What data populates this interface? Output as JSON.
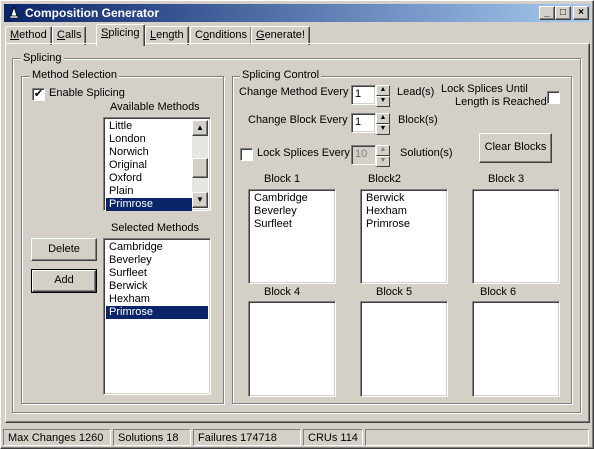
{
  "window": {
    "title": "Composition Generator",
    "minimize_glyph": "_",
    "maximize_glyph": "□",
    "close_glyph": "×"
  },
  "tabs": [
    {
      "pre": "",
      "accel": "M",
      "post": "ethod"
    },
    {
      "pre": "",
      "accel": "C",
      "post": "alls"
    },
    {
      "pre": "",
      "accel": "S",
      "post": "plicing"
    },
    {
      "pre": "",
      "accel": "L",
      "post": "ength"
    },
    {
      "pre": "C",
      "accel": "o",
      "post": "nditions"
    },
    {
      "pre": "",
      "accel": "G",
      "post": "enerate!"
    }
  ],
  "active_tab": "Splicing",
  "splicing": {
    "group_label": "Splicing",
    "method_selection": {
      "label": "Method Selection",
      "enable_label": "Enable Splicing",
      "enable_checked": true,
      "available_label": "Available Methods",
      "available_methods": [
        "Little",
        "London",
        "Norwich",
        "Original",
        "Oxford",
        "Plain",
        "Primrose"
      ],
      "available_selected": "Primrose",
      "selected_label": "Selected Methods",
      "selected_methods": [
        "Cambridge",
        "Beverley",
        "Surfleet",
        "Berwick",
        "Hexham",
        "Primrose"
      ],
      "selected_selected": "Primrose",
      "delete_button": "Delete",
      "add_button": "Add"
    },
    "control": {
      "label": "Splicing Control",
      "change_method_label": "Change Method Every",
      "change_method_value": "1",
      "change_method_unit": "Lead(s)",
      "lock_until_label_1": "Lock Splices Until",
      "lock_until_label_2": "Length is Reached",
      "lock_until_checked": false,
      "change_block_label": "Change Block Every",
      "change_block_value": "1",
      "change_block_unit": "Block(s)",
      "lock_every_label": "Lock Splices Every",
      "lock_every_checked": false,
      "lock_every_value": "10",
      "lock_every_unit": "Solution(s)",
      "clear_blocks_button": "Clear Blocks",
      "blocks": [
        {
          "title": "Block 1",
          "items": [
            "Cambridge",
            "Beverley",
            "Surfleet"
          ]
        },
        {
          "title": "Block2",
          "items": [
            "Berwick",
            "Hexham",
            "Primrose"
          ]
        },
        {
          "title": "Block 3",
          "items": []
        },
        {
          "title": "Block 4",
          "items": []
        },
        {
          "title": "Block 5",
          "items": []
        },
        {
          "title": "Block 6",
          "items": []
        }
      ]
    }
  },
  "status": {
    "max_changes": "Max Changes 1260",
    "solutions": "Solutions 18",
    "failures": "Failures  174718",
    "crus": "CRUs 114"
  },
  "icons": {
    "app": "bell-icon",
    "check": "✔",
    "up": "▲",
    "down": "▼"
  }
}
